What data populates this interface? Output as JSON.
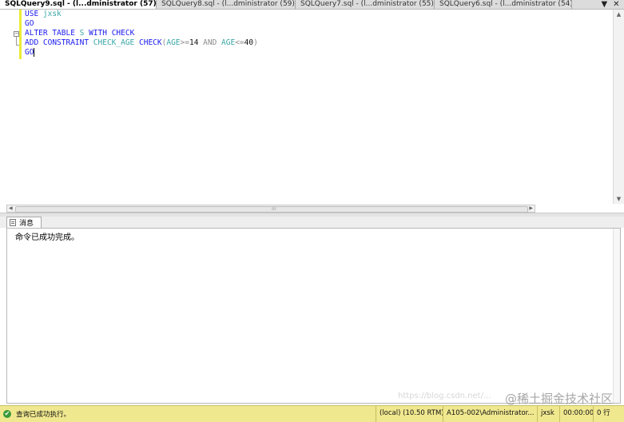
{
  "tabs": [
    {
      "label": "SQLQuery9.sql - (l...dministrator (57))*",
      "active": true
    },
    {
      "label": "SQLQuery8.sql - (l...dministrator (59))*",
      "active": false
    },
    {
      "label": "SQLQuery7.sql - (l...dministrator (55))*",
      "active": false
    },
    {
      "label": "SQLQuery6.sql - (l...dministrator (54))*",
      "active": false
    }
  ],
  "tab_tools": {
    "dropdown": "▼",
    "close": "✕"
  },
  "editor": {
    "lines": [
      [
        {
          "t": "USE ",
          "c": "kw"
        },
        {
          "t": "jxsk",
          "c": "id"
        }
      ],
      [
        {
          "t": "GO",
          "c": "kw"
        }
      ],
      [
        {
          "t": "ALTER TABLE ",
          "c": "kw"
        },
        {
          "t": "S ",
          "c": "id"
        },
        {
          "t": "WITH CHECK",
          "c": "kw"
        }
      ],
      [
        {
          "t": "ADD CONSTRAINT ",
          "c": "kw"
        },
        {
          "t": "CHECK_AGE ",
          "c": "id"
        },
        {
          "t": "CHECK",
          "c": "kw"
        },
        {
          "t": "(",
          "c": "op"
        },
        {
          "t": "AGE",
          "c": "id"
        },
        {
          "t": ">=",
          "c": "op"
        },
        {
          "t": "14 ",
          "c": "num"
        },
        {
          "t": "AND ",
          "c": "op"
        },
        {
          "t": "AGE",
          "c": "id"
        },
        {
          "t": "<=",
          "c": "op"
        },
        {
          "t": "40",
          "c": "num"
        },
        {
          "t": ")",
          "c": "op"
        }
      ],
      [
        {
          "t": "GO",
          "c": "kw"
        }
      ]
    ],
    "colors": {
      "keyword": "#1a1af0",
      "identifier": "#3aa6a6",
      "operator": "#8c8c8c"
    }
  },
  "results": {
    "tab_label": "消息",
    "message": "命令已成功完成。"
  },
  "status": {
    "left_icon": "✔",
    "left_text": "查询已成功执行。",
    "server": "(local) (10.50 RTM)",
    "user": "A105-002\\Administrator...",
    "database": "jxsk",
    "time": "00:00:00",
    "rows": "0 行",
    "color": "#f0e88f"
  },
  "watermark": {
    "text": "@稀土掘金技术社区",
    "url": "https://blog.csdn.net/..."
  }
}
